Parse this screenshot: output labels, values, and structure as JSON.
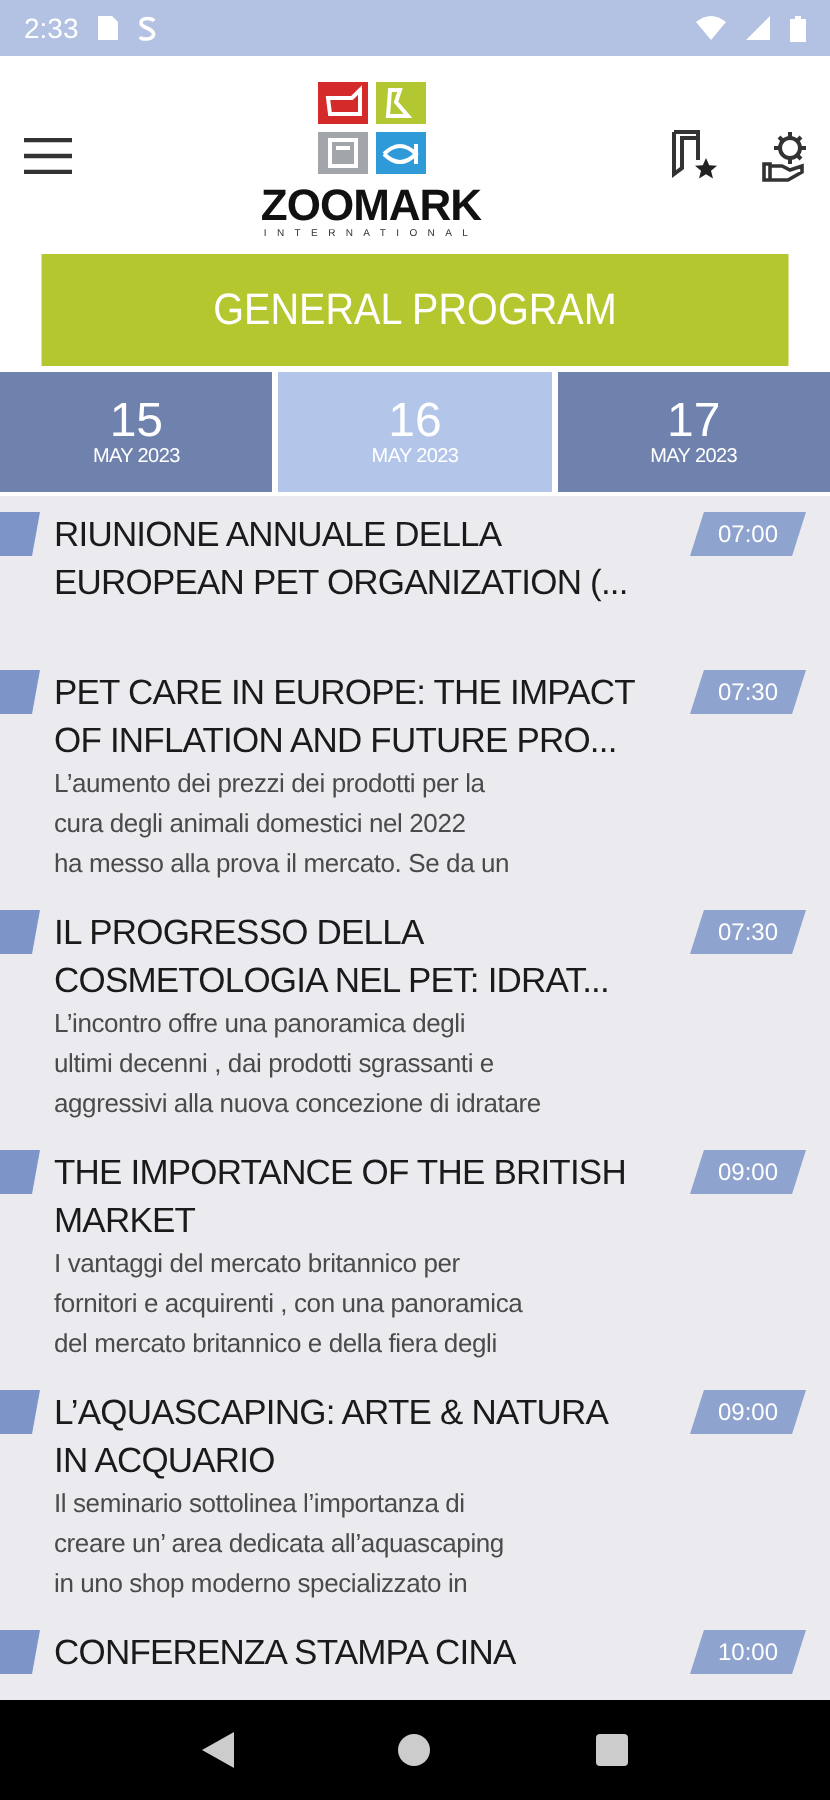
{
  "status_bar": {
    "time": "2:33"
  },
  "header": {
    "logo_name": "ZOOMARK",
    "logo_subtitle": "INTERNATIONAL"
  },
  "banner": {
    "title": "GENERAL PROGRAM"
  },
  "days": [
    {
      "day": "15",
      "month": "MAY 2023",
      "selected": false
    },
    {
      "day": "16",
      "month": "MAY 2023",
      "selected": true
    },
    {
      "day": "17",
      "month": "MAY 2023",
      "selected": false
    }
  ],
  "events": [
    {
      "title": "RIUNIONE ANNUALE DELLA\nEUROPEAN PET ORGANIZATION (...",
      "time": "07:00"
    },
    {
      "title": "PET CARE IN EUROPE: THE IMPACT\nOF INFLATION AND FUTURE PRO...",
      "description": "L’aumento dei prezzi dei prodotti per la\ncura degli animali domestici nel 2022\nha messo alla prova il mercato. Se da un",
      "time": "07:30"
    },
    {
      "title": "IL PROGRESSO DELLA\nCOSMETOLOGIA NEL PET: IDRAT...",
      "description": "L’incontro offre una  panoramica degli\nultimi decenni , dai prodotti sgrassanti e\naggressivi alla nuova concezione di idratare",
      "time": "07:30"
    },
    {
      "title": "THE IMPORTANCE OF THE BRITISH\nMARKET",
      "description": "I vantaggi del  mercato britannico per\nfornitori e acquirenti , con una panoramica\ndel mercato britannico e della fiera degli",
      "time": "09:00"
    },
    {
      "title": "L’AQUASCAPING: ARTE & NATURA\nIN ACQUARIO",
      "description": "Il seminario sottolinea l’importanza di\ncreare un’ area dedicata all’aquascaping\nin uno shop moderno specializzato in",
      "time": "09:00"
    },
    {
      "title": "CONFERENZA STAMPA CINA",
      "time": "10:00"
    }
  ]
}
